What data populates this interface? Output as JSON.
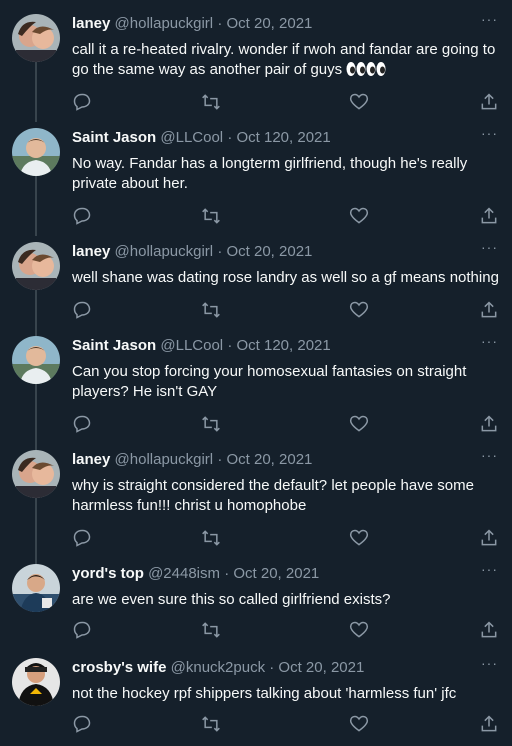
{
  "tweets": [
    {
      "name": "laney",
      "handle": "@hollapuckgirl",
      "date": "Oct 20, 2021",
      "text": "call it a re-heated rivalry. wonder if rwoh and fandar are going to go the same way as another pair of guys",
      "emoji": "👀👀",
      "avatar": "couple-avatar"
    },
    {
      "name": "Saint Jason",
      "handle": "@LLCool",
      "date": "Oct 120, 2021",
      "text": "No way. Fandar has a longterm girlfriend, though he's really private about her.",
      "avatar": "man-avatar"
    },
    {
      "name": "laney",
      "handle": "@hollapuckgirl",
      "date": "Oct 20, 2021",
      "text": "well shane was dating rose landry as well so a gf means nothing",
      "avatar": "couple-avatar"
    },
    {
      "name": "Saint Jason",
      "handle": "@LLCool",
      "date": "Oct 120, 2021",
      "text": "Can you stop forcing your homosexual fantasies on straight players? He isn't GAY",
      "avatar": "man-avatar"
    },
    {
      "name": "laney",
      "handle": "@hollapuckgirl",
      "date": "Oct 20, 2021",
      "text": "why is straight considered the default? let people have some harmless fun!!! christ u homophobe",
      "avatar": "couple-avatar"
    },
    {
      "name": "yord's top",
      "handle": "@2448ism",
      "date": "Oct 20, 2021",
      "text": "are we even sure this so called girlfriend exists?",
      "avatar": "player-avatar"
    },
    {
      "name": "crosby's wife",
      "handle": "@knuck2puck",
      "date": "Oct 20, 2021",
      "text": "not the hockey rpf shippers talking about 'harmless fun' jfc",
      "avatar": "hockey-avatar"
    }
  ],
  "separator": "·",
  "more_glyph": "···",
  "colors": {
    "background": "#15202b",
    "text": "#f7f9f9",
    "muted": "#8b98a5",
    "thread_line": "#38444d"
  }
}
